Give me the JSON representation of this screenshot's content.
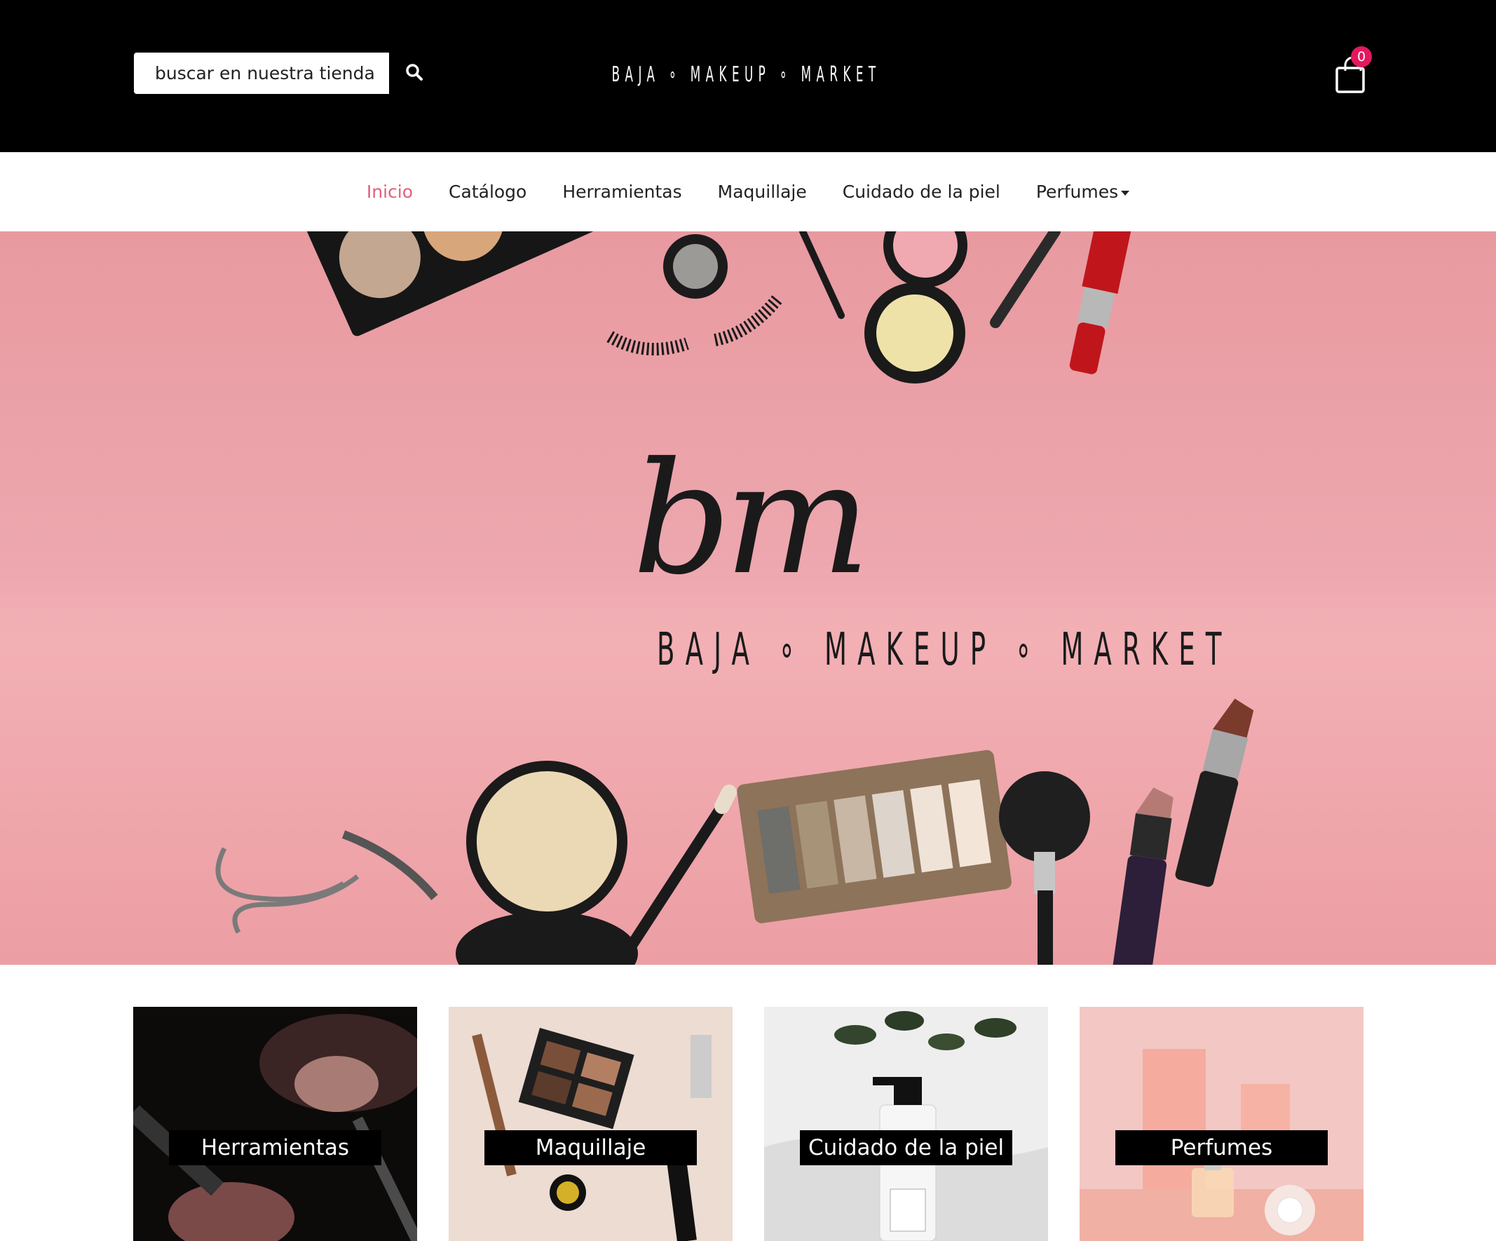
{
  "header": {
    "search": {
      "placeholder": "buscar en nuestra tienda"
    },
    "search_icon": "search-icon",
    "brand": "BAJA ∘ MAKEUP ∘ MARKET",
    "cart": {
      "icon": "shopping-bag-icon",
      "count": "0",
      "badge_color": "#e4185f"
    }
  },
  "nav": {
    "active_color": "#e0607a",
    "items": [
      {
        "label": "Inicio"
      },
      {
        "label": "Catálogo"
      },
      {
        "label": "Herramientas"
      },
      {
        "label": "Maquillaje"
      },
      {
        "label": "Cuidado de la piel"
      },
      {
        "label": "Perfumes"
      }
    ]
  },
  "hero": {
    "monogram": "bm",
    "brand": "BAJA ∘ MAKEUP ∘ MARKET",
    "background_color": "#ec9fa5"
  },
  "categories": [
    {
      "label": "Herramientas"
    },
    {
      "label": "Maquillaje"
    },
    {
      "label": "Cuidado de la piel"
    },
    {
      "label": "Perfumes"
    }
  ]
}
